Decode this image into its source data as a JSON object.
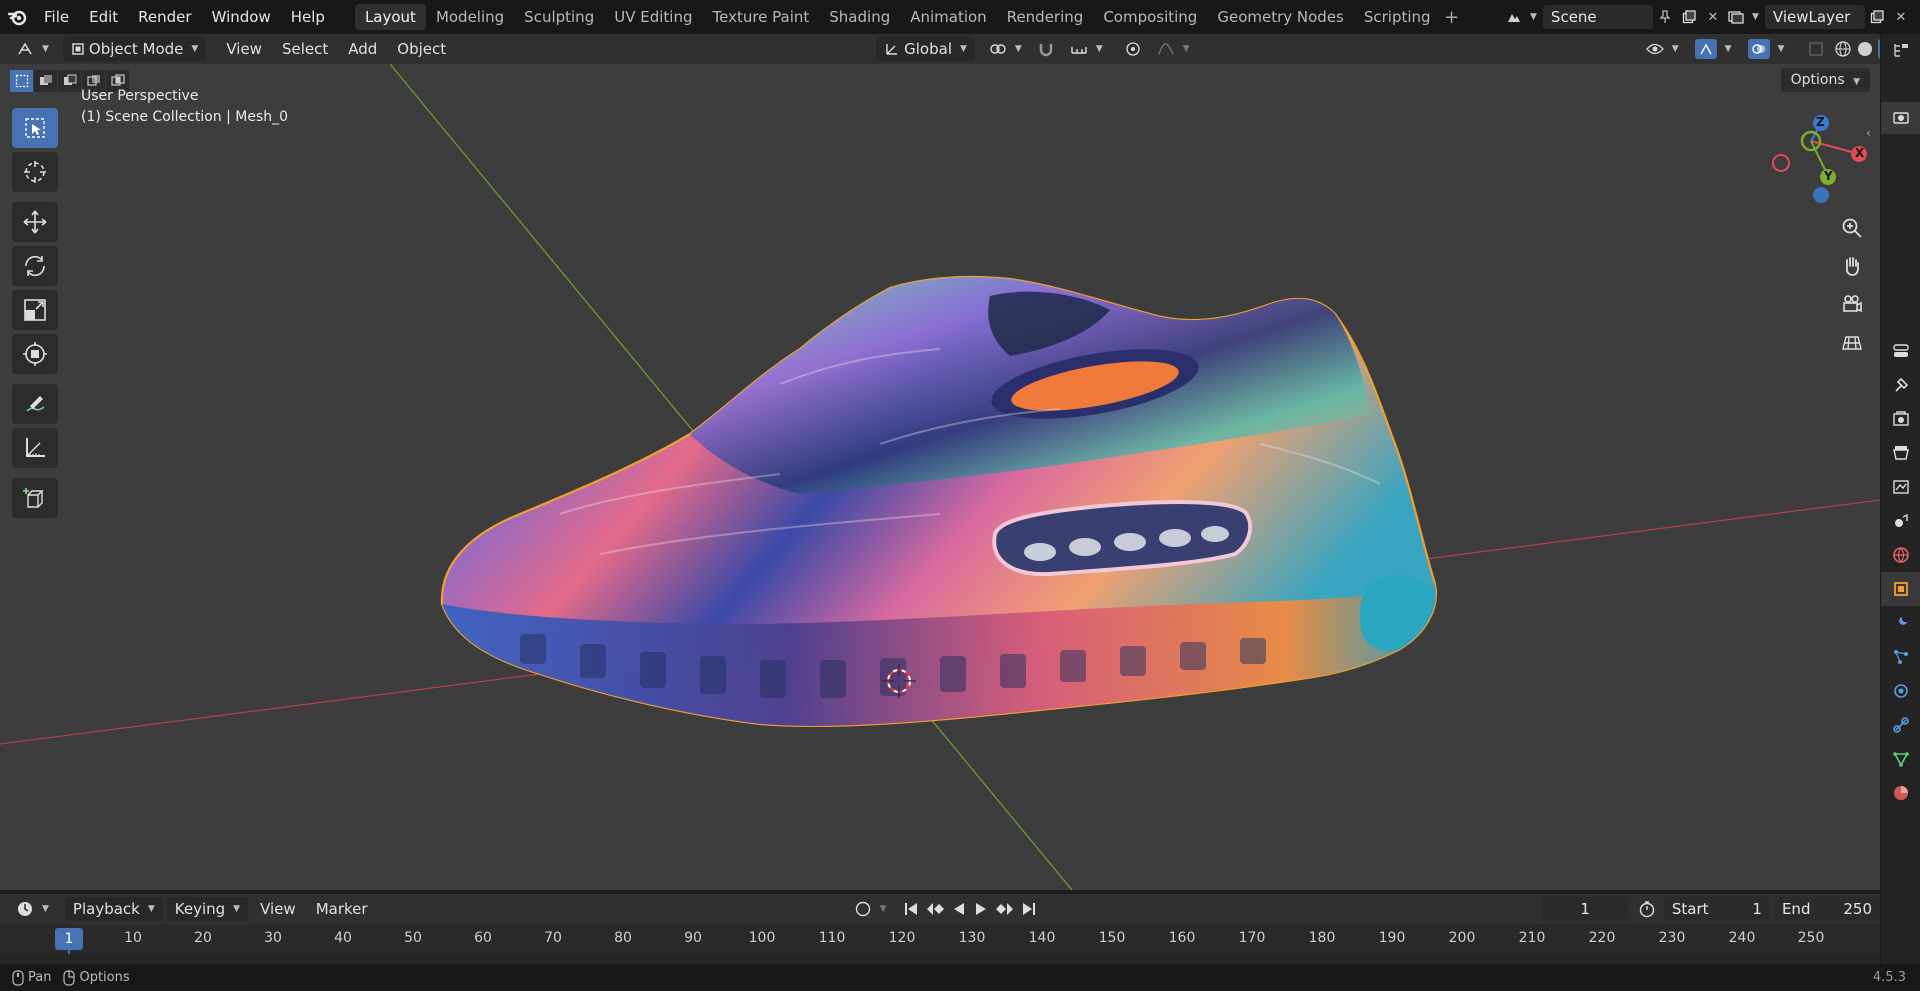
{
  "topbar": {
    "menus": [
      "File",
      "Edit",
      "Render",
      "Window",
      "Help"
    ],
    "workspaces": [
      "Layout",
      "Modeling",
      "Sculpting",
      "UV Editing",
      "Texture Paint",
      "Shading",
      "Animation",
      "Rendering",
      "Compositing",
      "Geometry Nodes",
      "Scripting"
    ],
    "active_workspace": "Layout",
    "scene": "Scene",
    "view_layer": "ViewLayer"
  },
  "viewport_header": {
    "mode": "Object Mode",
    "menus": [
      "View",
      "Select",
      "Add",
      "Object"
    ],
    "transform_orientation": "Global",
    "options_label": "Options"
  },
  "viewport": {
    "perspective_label": "User Perspective",
    "collection_label": "(1) Scene Collection | Mesh_0",
    "gizmo": {
      "x": "X",
      "y": "Y",
      "z": "Z"
    }
  },
  "timeline": {
    "menus": [
      "Playback",
      "Keying",
      "View",
      "Marker"
    ],
    "current_frame": "1",
    "start_label": "Start",
    "start_value": "1",
    "end_label": "End",
    "end_value": "250",
    "ticks": [
      "1",
      "10",
      "20",
      "30",
      "40",
      "50",
      "60",
      "70",
      "80",
      "90",
      "100",
      "110",
      "120",
      "130",
      "140",
      "150",
      "160",
      "170",
      "180",
      "190",
      "200",
      "210",
      "220",
      "230",
      "240",
      "250"
    ]
  },
  "status": {
    "pan_label": "Pan",
    "options_label": "Options",
    "version": "4.5.3"
  },
  "colors": {
    "accent": "#4772b3",
    "x_axis": "#e44a57",
    "y_axis": "#7fae2e",
    "z_axis": "#3b7bd6",
    "selection_outline": "#f0a030"
  }
}
